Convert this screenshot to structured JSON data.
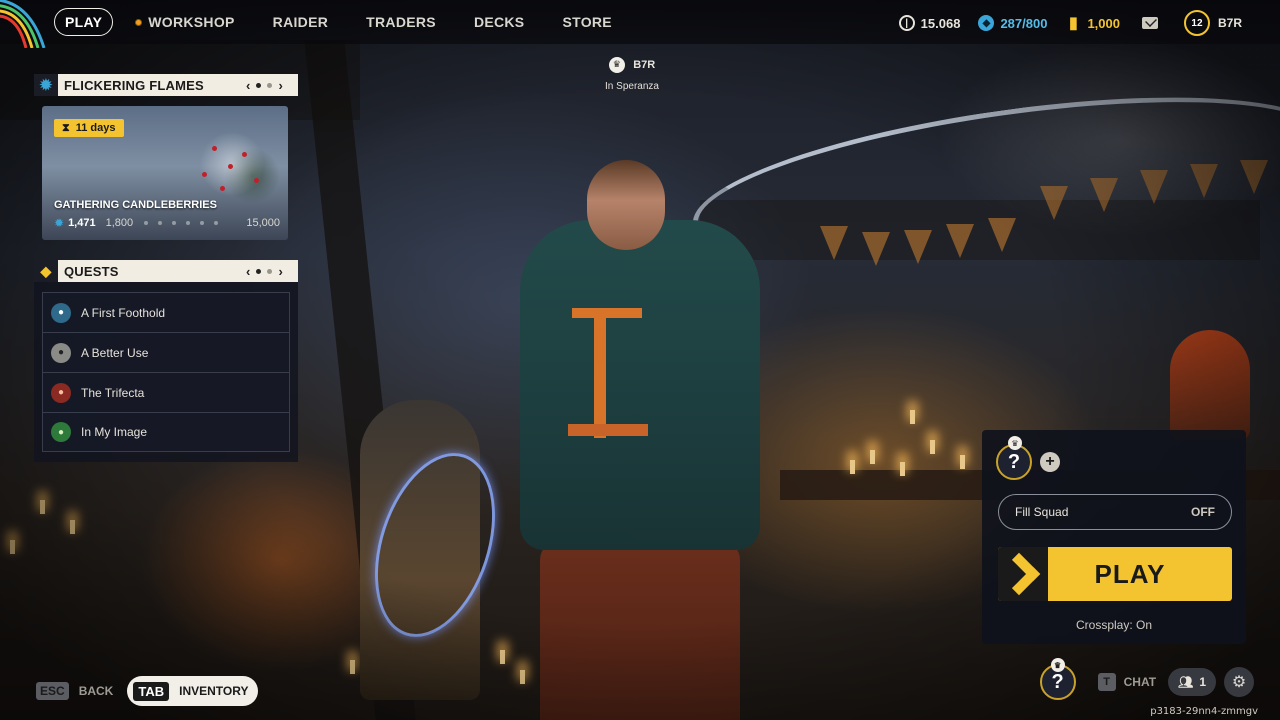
{
  "nav": {
    "items": [
      {
        "label": "PLAY",
        "active": true
      },
      {
        "label": "WORKSHOP",
        "notification": true
      },
      {
        "label": "RAIDER"
      },
      {
        "label": "TRADERS"
      },
      {
        "label": "DECKS"
      },
      {
        "label": "STORE"
      }
    ]
  },
  "currencies": {
    "coins": "15.068",
    "blue": "287/800",
    "gold": "1,000"
  },
  "profile": {
    "level": "12",
    "name": "B7R"
  },
  "player_tag": {
    "name": "B7R",
    "location": "In Speranza"
  },
  "event": {
    "header": "FLICKERING FLAMES",
    "days_left": "11 days",
    "title": "GATHERING CANDLEBERRIES",
    "current": "1,471",
    "milestone": "1,800",
    "max": "15,000"
  },
  "quests": {
    "header": "QUESTS",
    "items": [
      {
        "label": "A First Foothold"
      },
      {
        "label": "A Better Use"
      },
      {
        "label": "The Trifecta"
      },
      {
        "label": "In My Image"
      }
    ]
  },
  "squad": {
    "slot_placeholder": "?",
    "fill_squad_label": "Fill Squad",
    "fill_squad_state": "OFF",
    "play_label": "PLAY",
    "crossplay": "Crossplay: On"
  },
  "bottom": {
    "esc_key": "ESC",
    "back_label": "BACK",
    "tab_key": "TAB",
    "inventory_label": "INVENTORY",
    "chat_key": "T",
    "chat_label": "CHAT",
    "friends_count": "1",
    "self_placeholder": "?"
  },
  "build_id": "p3183-29nn4-zmmgv",
  "colors": {
    "accent_yellow": "#f4c430",
    "blue_currency": "#55bce8",
    "panel_header_bg": "#f2ede2"
  }
}
